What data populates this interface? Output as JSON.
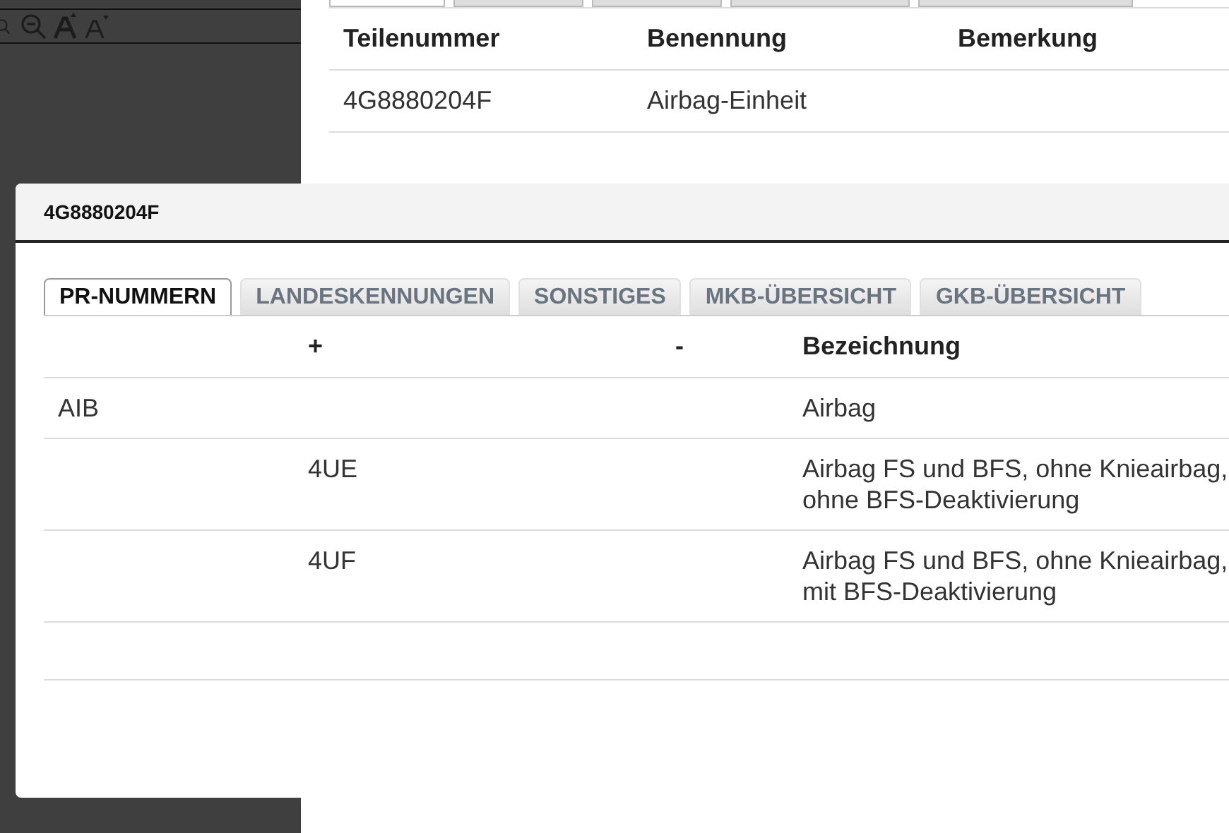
{
  "background_table": {
    "columns": [
      "Teilenummer",
      "Benennung",
      "Bemerkung"
    ],
    "rows": [
      [
        "4G8880204F",
        "Airbag-Einheit",
        ""
      ]
    ]
  },
  "dialog": {
    "title": "4G8880204F",
    "tabs": [
      {
        "label": "PR-NUMMERN",
        "selected": true
      },
      {
        "label": "LANDESKENNUNGEN",
        "selected": false
      },
      {
        "label": "SONSTIGES",
        "selected": false
      },
      {
        "label": "MKB-ÜBERSICHT",
        "selected": false
      },
      {
        "label": "GKB-ÜBERSICHT",
        "selected": false
      }
    ],
    "table": {
      "columns": [
        "",
        "+",
        "-",
        "Bezeichnung"
      ],
      "rows": [
        [
          "AIB",
          "",
          "",
          "Airbag"
        ],
        [
          "",
          "4UE",
          "",
          "Airbag FS und BFS, ohne Knieairbag,\nohne BFS-Deaktivierung"
        ],
        [
          "",
          "4UF",
          "",
          "Airbag FS und BFS, ohne Knieairbag,\nmit BFS-Deaktivierung"
        ]
      ]
    }
  }
}
